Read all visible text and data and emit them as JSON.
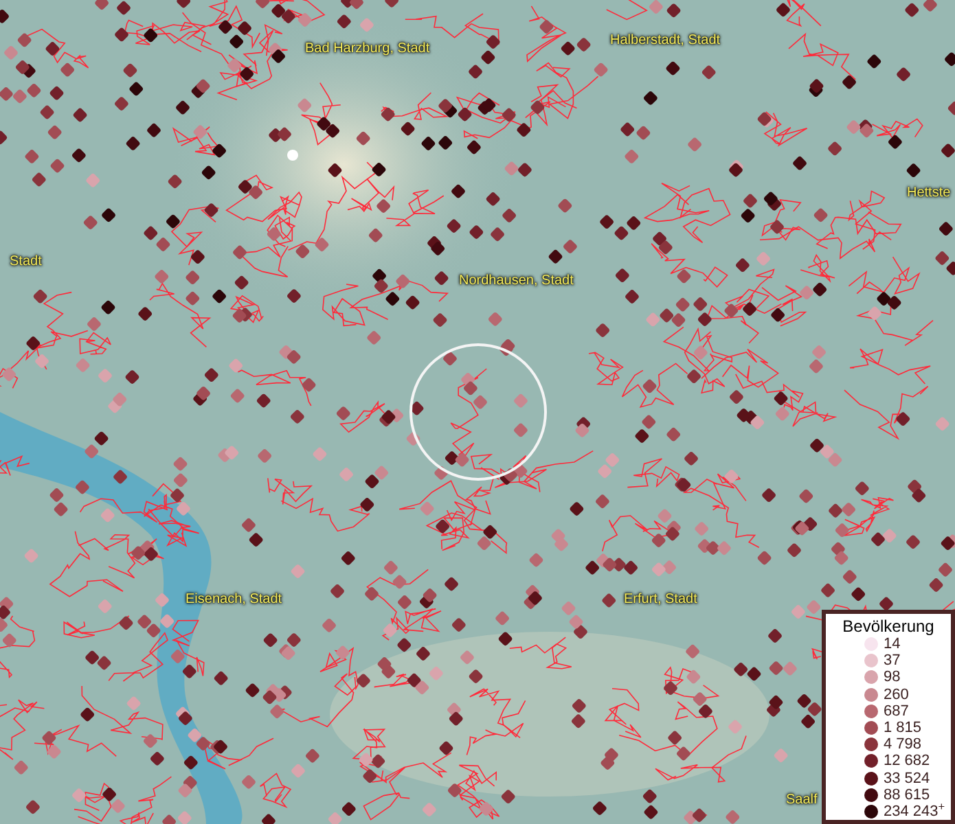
{
  "map": {
    "labels": [
      {
        "text": "Bad Harzburg, Stadt"
      },
      {
        "text": "Halberstadt, Stadt"
      },
      {
        "text": "Hettste"
      },
      {
        "text": "Stadt"
      },
      {
        "text": "Nordhausen, Stadt"
      },
      {
        "text": "Eisenach, Stadt"
      },
      {
        "text": "Erfurt, Stadt"
      },
      {
        "text": "Saalf"
      }
    ]
  },
  "legend": {
    "title": "Bevölkerung",
    "items": [
      {
        "label": "14",
        "color": "#f7e4ee"
      },
      {
        "label": "37",
        "color": "#e9c4cc"
      },
      {
        "label": "98",
        "color": "#d9a4ac"
      },
      {
        "label": "260",
        "color": "#c98890"
      },
      {
        "label": "687",
        "color": "#b86870"
      },
      {
        "label": "1 815",
        "color": "#a24c54"
      },
      {
        "label": "4 798",
        "color": "#8a343c"
      },
      {
        "label": "12 682",
        "color": "#72202a"
      },
      {
        "label": "33 524",
        "color": "#5a1219"
      },
      {
        "label": "88 615",
        "color": "#420a10"
      },
      {
        "label": "234 243$^{+}$",
        "color": "#2c0609"
      }
    ]
  }
}
